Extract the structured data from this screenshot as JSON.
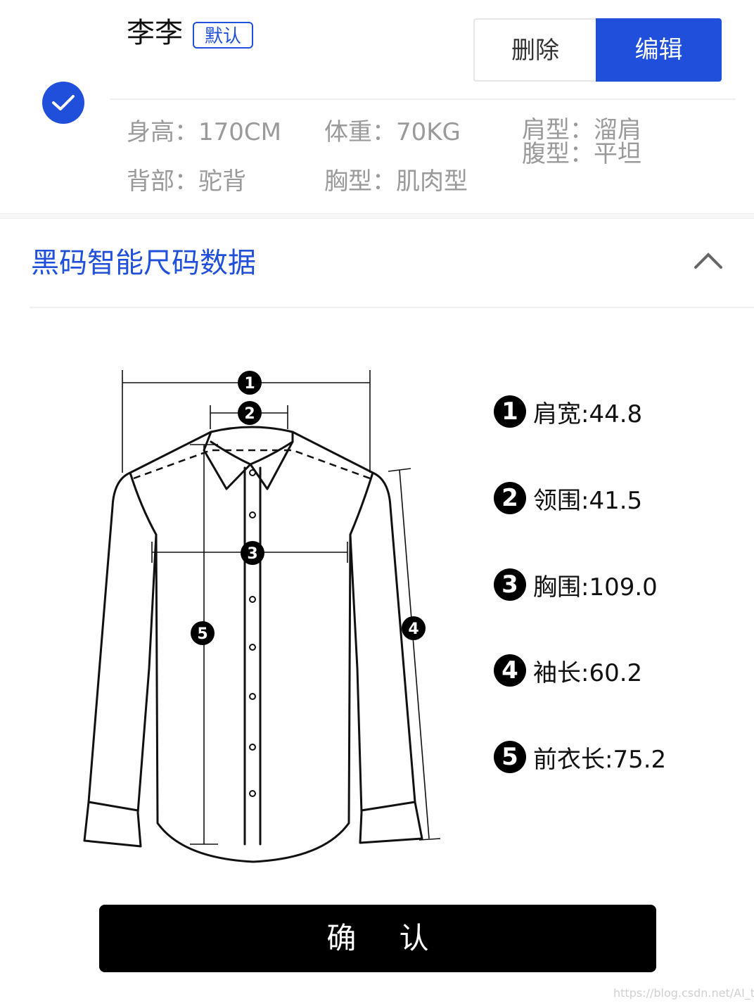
{
  "profile": {
    "name": "李李",
    "default_badge": "默认",
    "delete_label": "删除",
    "edit_label": "编辑",
    "selected": true,
    "attributes": {
      "height": "身高：170CM",
      "weight": "体重：70KG",
      "shoulder": "肩型：溜肩",
      "belly": "腹型：平坦",
      "back": "背部：驼背",
      "chest": "胸型：肌肉型"
    }
  },
  "section": {
    "title": "黑码智能尺码数据",
    "expanded": true
  },
  "measurements": [
    {
      "num": "1",
      "text": "肩宽:44.8"
    },
    {
      "num": "2",
      "text": "领围:41.5"
    },
    {
      "num": "3",
      "text": "胸围:109.0"
    },
    {
      "num": "4",
      "text": "袖长:60.2"
    },
    {
      "num": "5",
      "text": "前衣长:75.2"
    }
  ],
  "diagram_markers": [
    "1",
    "2",
    "3",
    "4",
    "5"
  ],
  "confirm_label": "确 认",
  "watermark": "https://blog.csdn.net/AI_top",
  "colors": {
    "accent": "#1f4fdb",
    "text_muted": "#9a9a9a"
  }
}
